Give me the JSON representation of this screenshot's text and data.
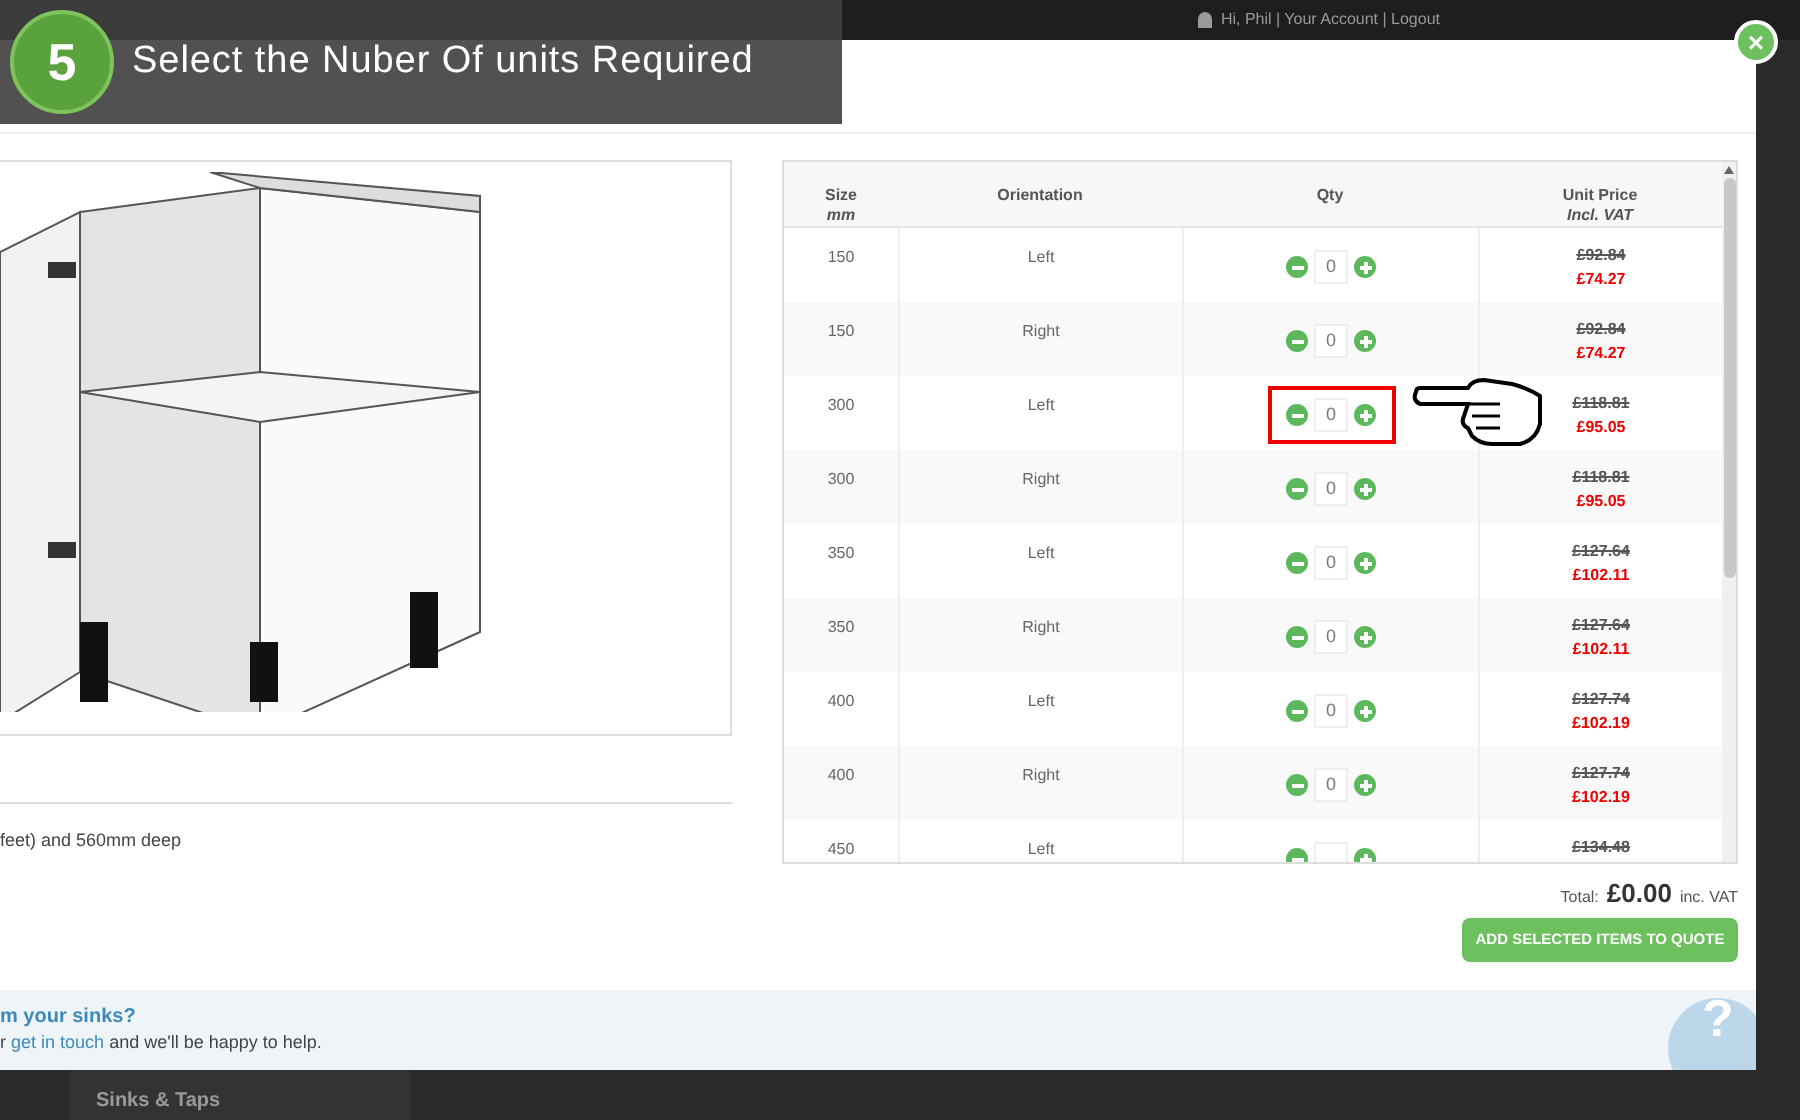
{
  "top_bar": {
    "account_links": "Hi, Phil | Your Account | Logout"
  },
  "step_banner": {
    "number": "5",
    "title": "Select the Nuber Of units Required"
  },
  "close_button": "×",
  "product": {
    "description": "feet) and 560mm deep"
  },
  "table": {
    "columns": [
      {
        "label": "Size",
        "sublabel": "mm"
      },
      {
        "label": "Orientation"
      },
      {
        "label": "Qty"
      },
      {
        "label": "Unit Price",
        "sublabel": "Incl. VAT"
      }
    ],
    "rows": [
      {
        "size": "150",
        "orientation": "Left",
        "qty": "0",
        "old_price": "£92.84",
        "price": "£74.27",
        "highlighted": false
      },
      {
        "size": "150",
        "orientation": "Right",
        "qty": "0",
        "old_price": "£92.84",
        "price": "£74.27",
        "highlighted": false
      },
      {
        "size": "300",
        "orientation": "Left",
        "qty": "0",
        "old_price": "£118.81",
        "price": "£95.05",
        "highlighted": true
      },
      {
        "size": "300",
        "orientation": "Right",
        "qty": "0",
        "old_price": "£118.81",
        "price": "£95.05",
        "highlighted": false
      },
      {
        "size": "350",
        "orientation": "Left",
        "qty": "0",
        "old_price": "£127.64",
        "price": "£102.11",
        "highlighted": false
      },
      {
        "size": "350",
        "orientation": "Right",
        "qty": "0",
        "old_price": "£127.64",
        "price": "£102.11",
        "highlighted": false
      },
      {
        "size": "400",
        "orientation": "Left",
        "qty": "0",
        "old_price": "£127.74",
        "price": "£102.19",
        "highlighted": false
      },
      {
        "size": "400",
        "orientation": "Right",
        "qty": "0",
        "old_price": "£127.74",
        "price": "£102.19",
        "highlighted": false
      },
      {
        "size": "450",
        "orientation": "Left",
        "old_price": "£134.48",
        "highlighted": false
      }
    ]
  },
  "total": {
    "label": "Total:",
    "amount": "£0.00",
    "suffix": "inc. VAT"
  },
  "add_button": "ADD SELECTED ITEMS TO QUOTE",
  "footer": {
    "heading": "m your sinks?",
    "before_link": "r",
    "link": "get in touch",
    "after_link": "and we'll be happy to help."
  },
  "help_button": "?",
  "background": {
    "menu_item": "Sinks & Taps"
  }
}
